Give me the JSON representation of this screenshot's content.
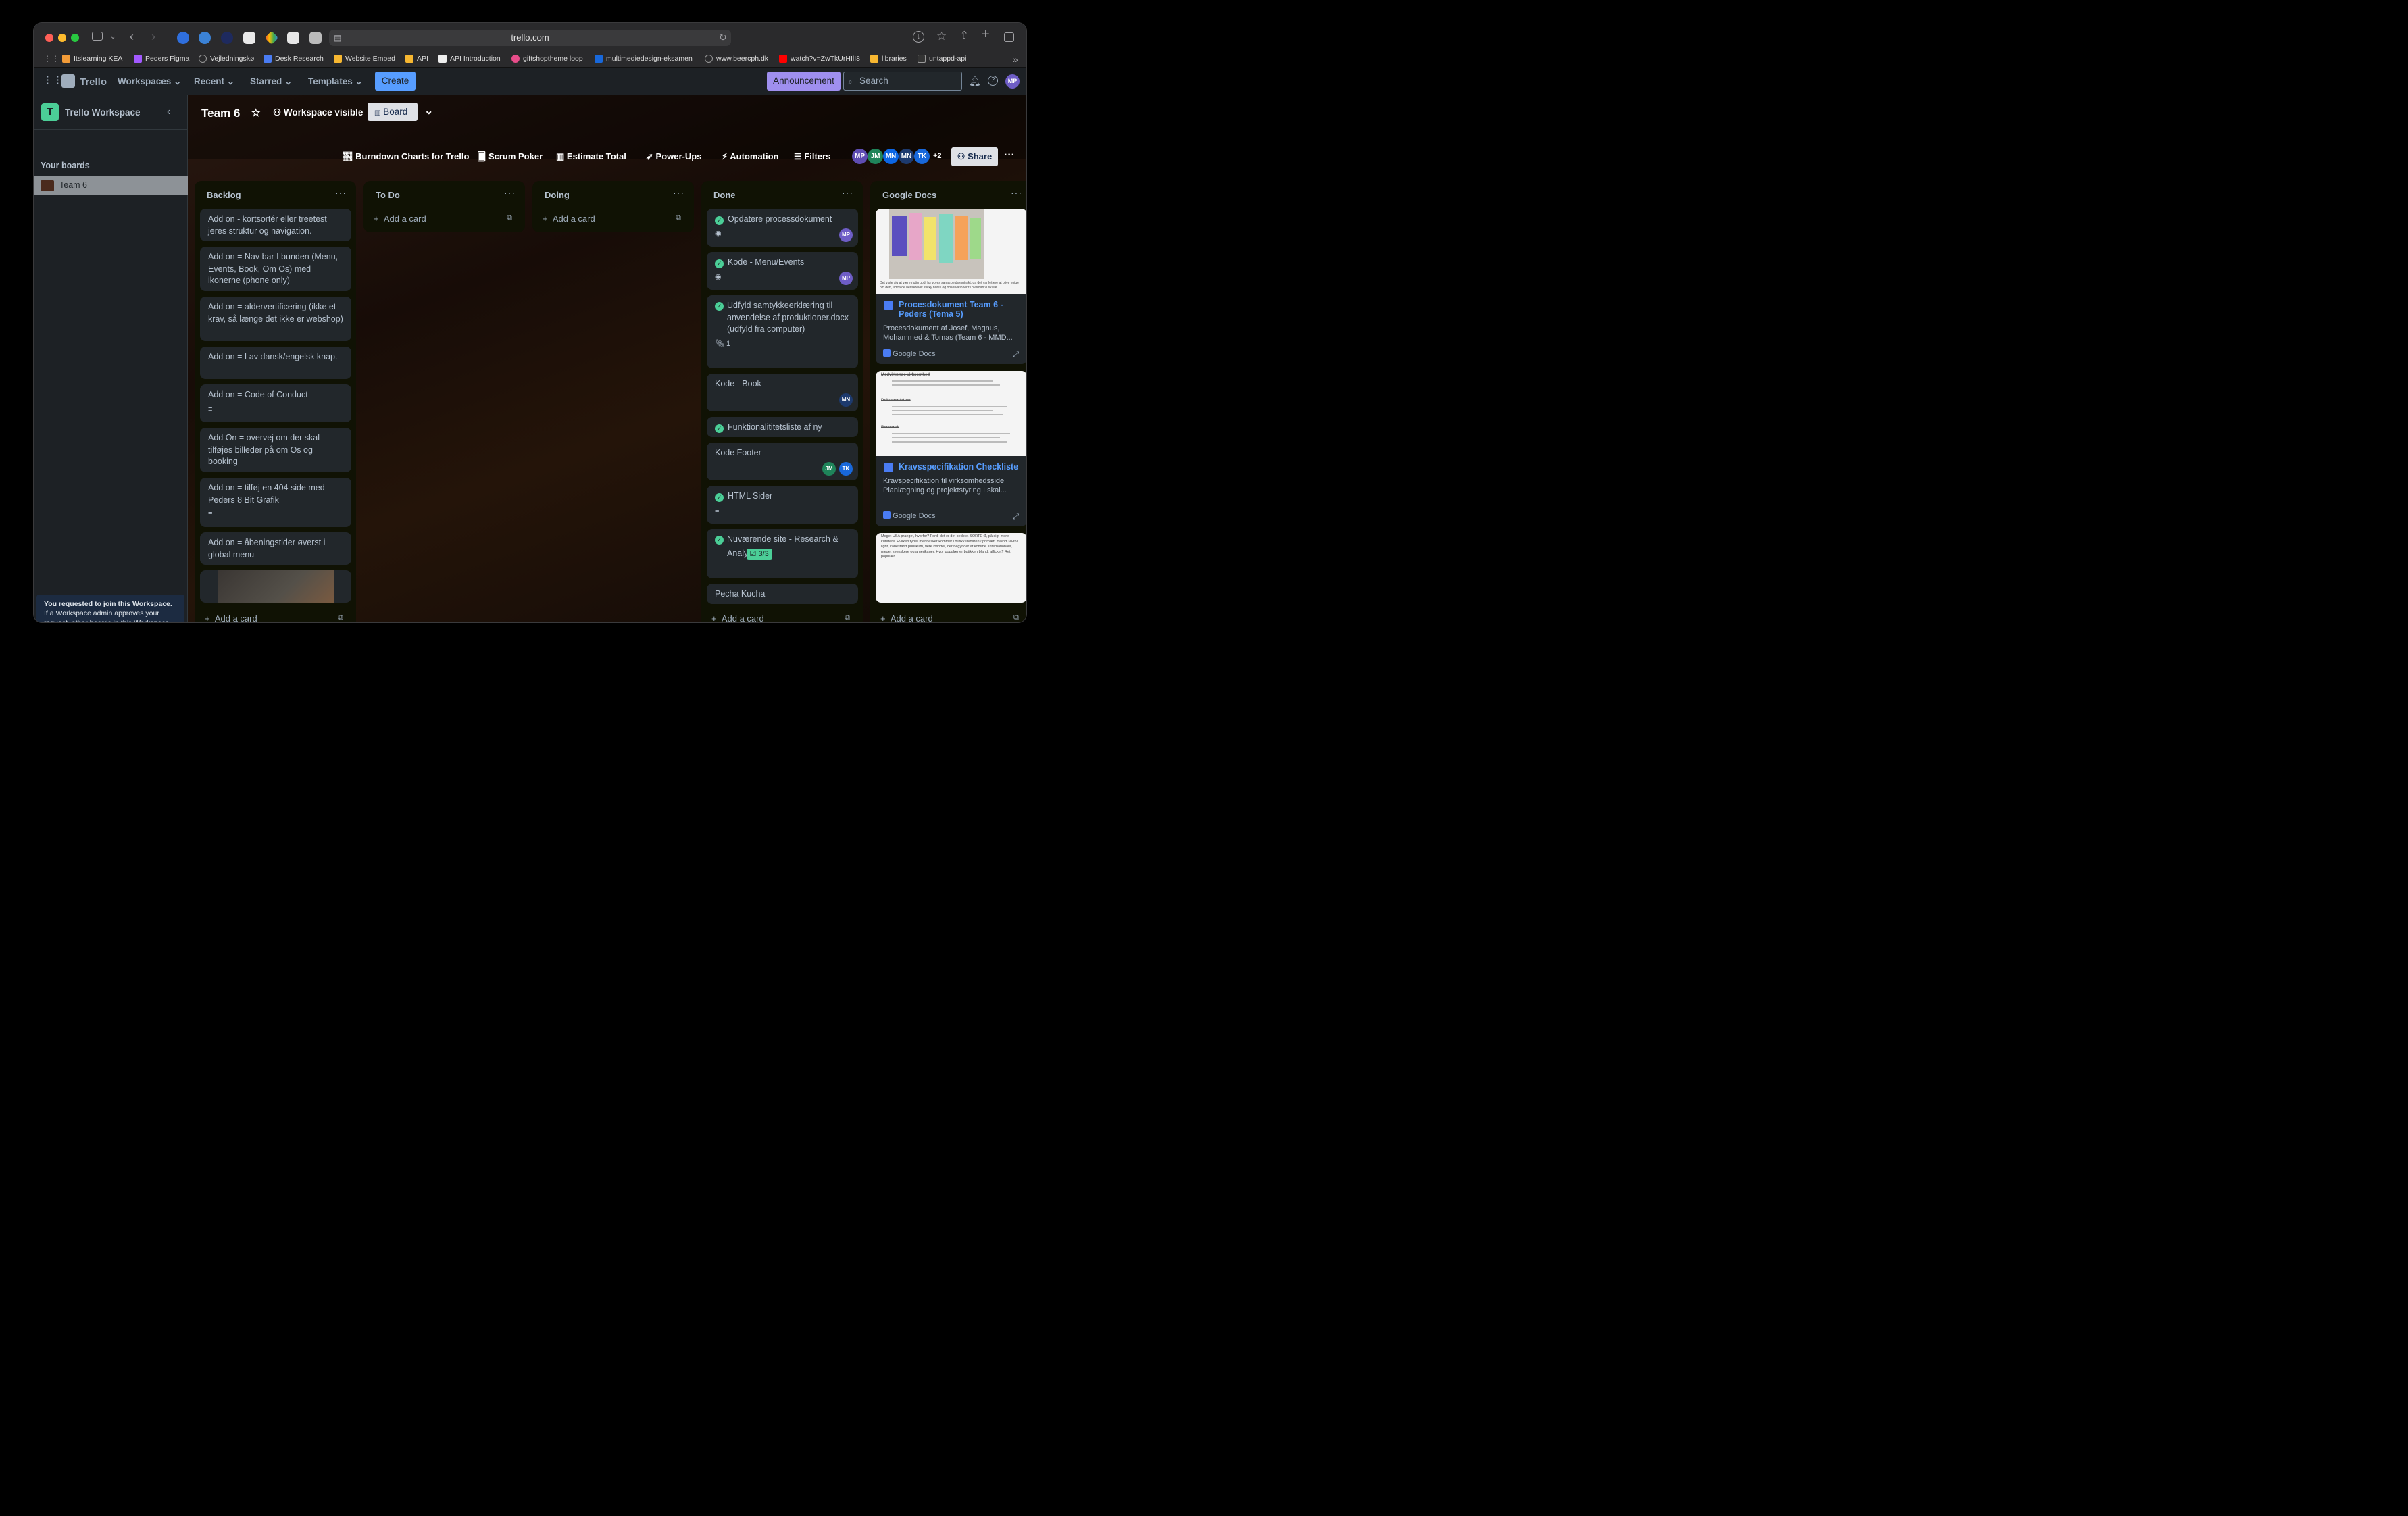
{
  "browser": {
    "url": "trello.com",
    "bookmarks": [
      "Itslearning KEA",
      "Peders Figma",
      "Vejledningskø",
      "Desk Research",
      "Website Embed",
      "API",
      "API Introduction",
      "giftshoptheme loop",
      "multimediedesign-eksamen",
      "www.beercph.dk",
      "watch?v=ZwTkUrHIlI8",
      "libraries",
      "untappd-api"
    ]
  },
  "header": {
    "brand": "Trello",
    "nav": [
      "Workspaces",
      "Recent",
      "Starred",
      "Templates"
    ],
    "create": "Create",
    "announcement": "Announcement",
    "search_placeholder": "Search",
    "user_initials": "MP"
  },
  "sidebar": {
    "workspace_initial": "T",
    "workspace_name": "Trello Workspace",
    "your_boards": "Your boards",
    "board": "Team 6",
    "notice_bold": "You requested to join this Workspace.",
    "notice_text": " If a Workspace admin approves your request, other boards in this Workspace will show up here."
  },
  "board": {
    "title": "Team 6",
    "visibility": "Workspace visible",
    "view": "Board",
    "powerups": [
      "Burndown Charts for Trello",
      "Scrum Poker",
      "Estimate Total",
      "Power-Ups",
      "Automation",
      "Filters"
    ],
    "members": [
      "MP",
      "JM",
      "MN",
      "MN",
      "TK"
    ],
    "members_more": "+2",
    "share": "Share"
  },
  "lists": [
    {
      "title": "Backlog",
      "add": "Add a card",
      "cards": [
        "Add on - kortsortér eller treetest jeres struktur og navigation.",
        "Add on = Nav bar I bunden (Menu, Events, Book, Om Os) med ikonerne (phone only)",
        "Add on = aldervertificering (ikke et krav, så længe det ikke er webshop)",
        "Add on = Lav dansk/engelsk knap.",
        "Add on = Code of Conduct",
        "Add On = overvej om der skal tilføjes billeder på om Os og booking",
        "Add on = tilføj en 404 side med Peders 8 Bit Grafik",
        "Add on = åbeningstider øverst i global menu"
      ]
    },
    {
      "title": "To Do",
      "add": "Add a card"
    },
    {
      "title": "Doing",
      "add": "Add a card"
    },
    {
      "title": "Done",
      "add": "Add a card",
      "cards": [
        "Opdatere processdokument",
        "Kode - Menu/Events",
        "Udfyld samtykkeerklæring til anvendelse af produktioner.docx (udfyld fra computer)",
        "Kode - Book",
        "Funktionalititetsliste af ny",
        "Kode Footer",
        "HTML Sider",
        "Nuværende site - Research & Analysis",
        "Pecha Kucha"
      ],
      "attach_count": "1",
      "checklist": "3/3",
      "members": {
        "c1": "MP",
        "c2": "MP",
        "c4": "MN",
        "c6a": "JM",
        "c6b": "TK"
      }
    },
    {
      "title": "Google Docs",
      "add": "Add a card",
      "docs": [
        {
          "title": "Procesdokument Team 6 - Peders (Tema 5)",
          "desc": "Procesdokument af Josef, Magnus, Mohammed & Tomas (Team 6 - MMD...",
          "source": "Google Docs",
          "snippet": "Det viste sig at være rigtig godt for vores samarbejdskontrakt, da det var lettere at blive enige om den, udfra de nedskrevet sticky notes og observationer til hvordan vi skulle"
        },
        {
          "title": "Kravsspecifikation Checkliste",
          "desc": "Kravspecifikation til virksomhedsside Planlægning og projektstyring I skal...",
          "source": "Google Docs",
          "snippet1": "Medvirkende virksomhed",
          "snippet2": "Dokumentation",
          "snippet3": "Research"
        },
        {
          "snippet": "Meget USA praeget, hvorfor? Fordi det er det bedste. SORTE Ø, på sigt mere kuratere. Hvilken typer mennesker kommer i butikken/baren? primært mænd 30-69, light, kabestarkt publikum, flere kvinder, der begynder at komme. Internationale, meget svenskere og amerikaner. Hvor populær er butikken blandt afficket? Ret populær."
        }
      ]
    }
  ]
}
